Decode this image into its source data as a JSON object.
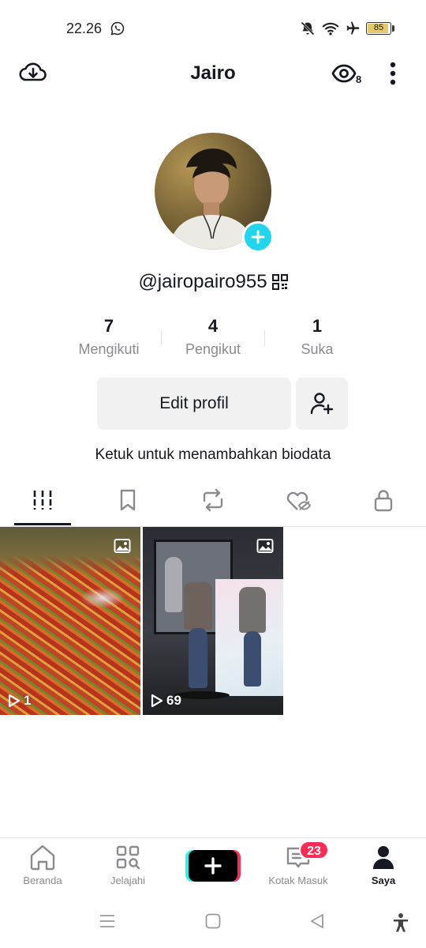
{
  "status_bar": {
    "time": "22.26",
    "battery": "85"
  },
  "header": {
    "title": "Jairo",
    "profile_views": "8"
  },
  "profile": {
    "username": "@jairopairo955",
    "stats": [
      {
        "value": "7",
        "label": "Mengikuti"
      },
      {
        "value": "4",
        "label": "Pengikut"
      },
      {
        "value": "1",
        "label": "Suka"
      }
    ],
    "edit_button": "Edit profil",
    "bio_prompt": "Ketuk untuk menambahkan biodata"
  },
  "tabs": [
    "videos-grid-icon",
    "bookmark-icon",
    "repost-icon",
    "liked-hidden-icon",
    "lock-icon"
  ],
  "videos": [
    {
      "plays": "1"
    },
    {
      "plays": "69"
    }
  ],
  "bottom_nav": {
    "items": [
      {
        "label": "Beranda"
      },
      {
        "label": "Jelajahi"
      },
      {
        "label": "Kotak Masuk"
      },
      {
        "label": "Saya"
      }
    ],
    "inbox_badge": "23"
  },
  "colors": {
    "accent_cyan": "#20d5ec",
    "badge_red": "#fe2c55",
    "text_primary": "#161823",
    "text_secondary": "#8a8b91"
  }
}
